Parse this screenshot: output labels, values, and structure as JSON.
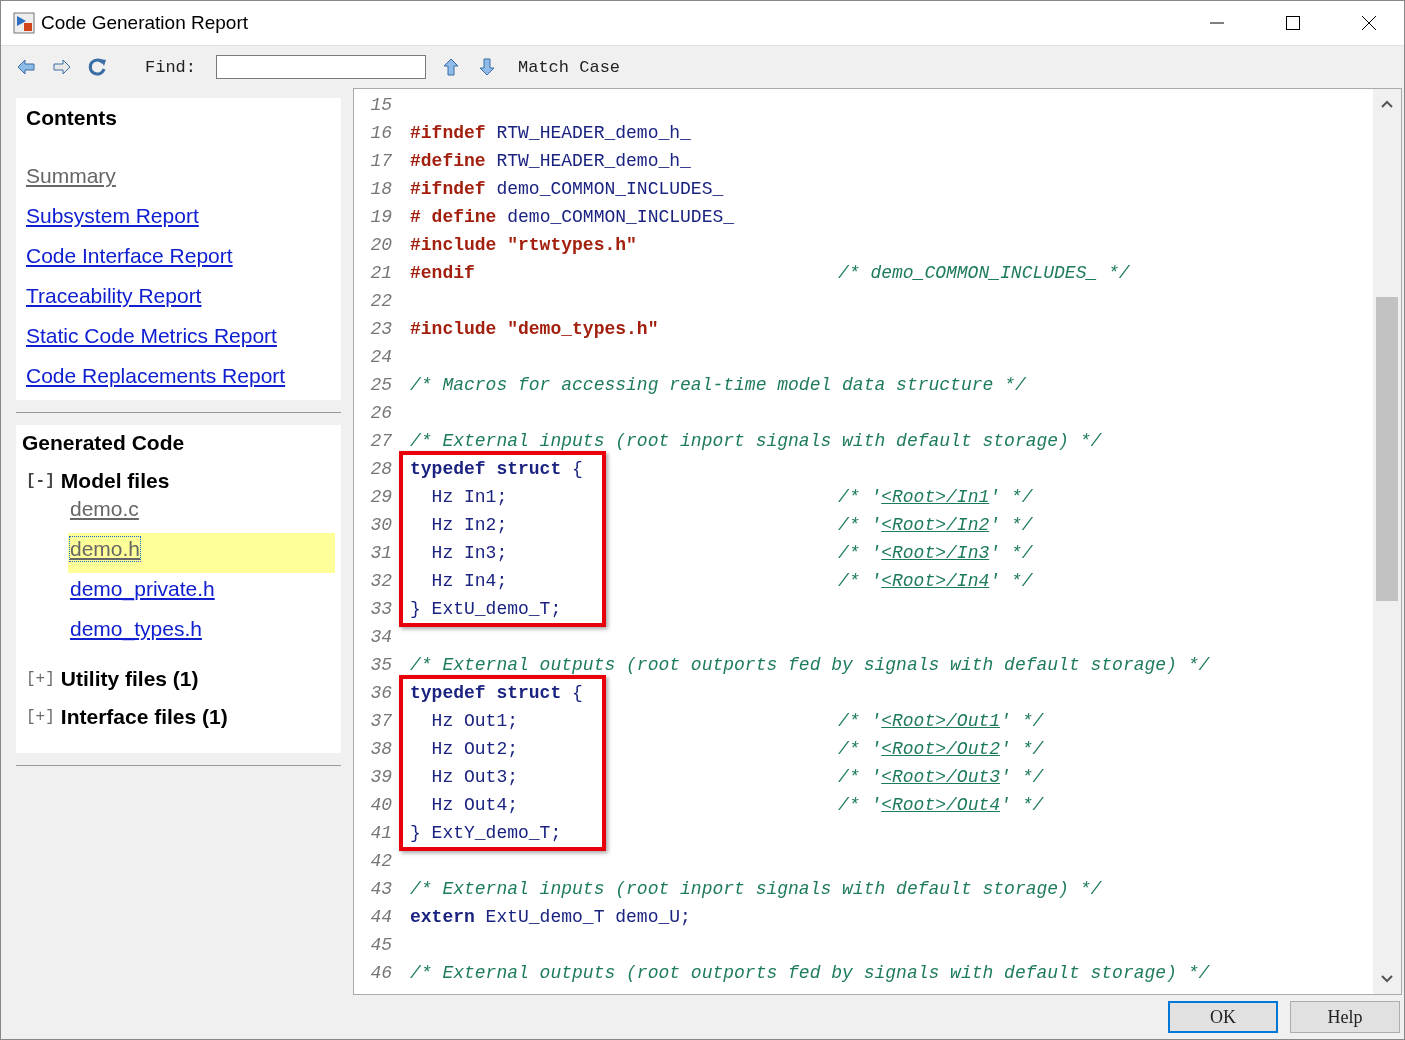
{
  "window": {
    "title": "Code Generation Report"
  },
  "toolbar": {
    "find_label": "Find:",
    "match_case": "Match Case"
  },
  "contents": {
    "title": "Contents",
    "links": [
      {
        "label": "Summary",
        "visited": true
      },
      {
        "label": "Subsystem Report",
        "visited": false
      },
      {
        "label": "Code Interface Report",
        "visited": false
      },
      {
        "label": "Traceability Report",
        "visited": false
      },
      {
        "label": "Static Code Metrics Report",
        "visited": false
      },
      {
        "label": "Code Replacements Report",
        "visited": false
      }
    ]
  },
  "generated_code": {
    "title": "Generated Code",
    "groups": [
      {
        "toggle": "[-]",
        "label": "Model files",
        "expanded": true,
        "files": [
          {
            "label": "demo.c",
            "visited": true,
            "selected": false
          },
          {
            "label": "demo.h",
            "visited": true,
            "selected": true
          },
          {
            "label": "demo_private.h",
            "visited": false,
            "selected": false
          },
          {
            "label": "demo_types.h",
            "visited": false,
            "selected": false
          }
        ]
      },
      {
        "toggle": "[+]",
        "label": "Utility files (1)",
        "expanded": false
      },
      {
        "toggle": "[+]",
        "label": "Interface files (1)",
        "expanded": false
      }
    ]
  },
  "code": {
    "lines": [
      {
        "number": "15",
        "boxed": false
      },
      {
        "number": "16",
        "boxed": false,
        "segments": [
          {
            "kind": "directive",
            "text": "#ifndef"
          },
          {
            "kind": "plain",
            "text": " RTW_HEADER_demo_h_"
          }
        ]
      },
      {
        "number": "17",
        "boxed": false,
        "segments": [
          {
            "kind": "directive",
            "text": "#define"
          },
          {
            "kind": "plain",
            "text": " RTW_HEADER_demo_h_"
          }
        ]
      },
      {
        "number": "18",
        "boxed": false,
        "segments": [
          {
            "kind": "directive",
            "text": "#ifndef"
          },
          {
            "kind": "plain",
            "text": " demo_COMMON_INCLUDES_"
          }
        ]
      },
      {
        "number": "19",
        "boxed": false,
        "segments": [
          {
            "kind": "directive",
            "text": "# define"
          },
          {
            "kind": "plain",
            "text": " demo_COMMON_INCLUDES_"
          }
        ]
      },
      {
        "number": "20",
        "boxed": false,
        "segments": [
          {
            "kind": "directive",
            "text": "#include \"rtwtypes.h\""
          }
        ]
      },
      {
        "number": "21",
        "boxed": false,
        "segments": [
          {
            "kind": "directive",
            "text": "#endif"
          }
        ],
        "trailing": [
          {
            "kind": "comment",
            "text": "/* demo_COMMON_INCLUDES_ */"
          }
        ]
      },
      {
        "number": "22",
        "boxed": false
      },
      {
        "number": "23",
        "boxed": false,
        "segments": [
          {
            "kind": "directive",
            "text": "#include \"demo_types.h\""
          }
        ]
      },
      {
        "number": "24",
        "boxed": false
      },
      {
        "number": "25",
        "boxed": false,
        "segments": [
          {
            "kind": "comment",
            "text": "/* Macros for accessing real-time model data structure */"
          }
        ]
      },
      {
        "number": "26",
        "boxed": false
      },
      {
        "number": "27",
        "boxed": false,
        "segments": [
          {
            "kind": "comment",
            "text": "/* External inputs (root inport signals with default storage) */"
          }
        ]
      },
      {
        "number": "28",
        "boxed": true,
        "segments": [
          {
            "kind": "keyword",
            "text": "typedef struct"
          },
          {
            "kind": "plain",
            "text": " {"
          }
        ]
      },
      {
        "number": "29",
        "boxed": true,
        "segments": [
          {
            "kind": "plain",
            "text": "  Hz In1;"
          }
        ],
        "trailing": [
          {
            "kind": "comment",
            "text": "/* '"
          },
          {
            "kind": "link",
            "text": "<Root>/In1"
          },
          {
            "kind": "comment",
            "text": "' */"
          }
        ]
      },
      {
        "number": "30",
        "boxed": true,
        "segments": [
          {
            "kind": "plain",
            "text": "  Hz In2;"
          }
        ],
        "trailing": [
          {
            "kind": "comment",
            "text": "/* '"
          },
          {
            "kind": "link",
            "text": "<Root>/In2"
          },
          {
            "kind": "comment",
            "text": "' */"
          }
        ]
      },
      {
        "number": "31",
        "boxed": true,
        "segments": [
          {
            "kind": "plain",
            "text": "  Hz In3;"
          }
        ],
        "trailing": [
          {
            "kind": "comment",
            "text": "/* '"
          },
          {
            "kind": "link",
            "text": "<Root>/In3"
          },
          {
            "kind": "comment",
            "text": "' */"
          }
        ]
      },
      {
        "number": "32",
        "boxed": true,
        "segments": [
          {
            "kind": "plain",
            "text": "  Hz In4;"
          }
        ],
        "trailing": [
          {
            "kind": "comment",
            "text": "/* '"
          },
          {
            "kind": "link",
            "text": "<Root>/In4"
          },
          {
            "kind": "comment",
            "text": "' */"
          }
        ]
      },
      {
        "number": "33",
        "boxed": true,
        "segments": [
          {
            "kind": "plain",
            "text": "} ExtU_demo_T;"
          }
        ]
      },
      {
        "number": "34",
        "boxed": false
      },
      {
        "number": "35",
        "boxed": false,
        "segments": [
          {
            "kind": "comment",
            "text": "/* External outputs (root outports fed by signals with default storage) */"
          }
        ]
      },
      {
        "number": "36",
        "boxed": true,
        "segments": [
          {
            "kind": "keyword",
            "text": "typedef struct"
          },
          {
            "kind": "plain",
            "text": " {"
          }
        ]
      },
      {
        "number": "37",
        "boxed": true,
        "segments": [
          {
            "kind": "plain",
            "text": "  Hz Out1;"
          }
        ],
        "trailing": [
          {
            "kind": "comment",
            "text": "/* '"
          },
          {
            "kind": "link",
            "text": "<Root>/Out1"
          },
          {
            "kind": "comment",
            "text": "' */"
          }
        ]
      },
      {
        "number": "38",
        "boxed": true,
        "segments": [
          {
            "kind": "plain",
            "text": "  Hz Out2;"
          }
        ],
        "trailing": [
          {
            "kind": "comment",
            "text": "/* '"
          },
          {
            "kind": "link",
            "text": "<Root>/Out2"
          },
          {
            "kind": "comment",
            "text": "' */"
          }
        ]
      },
      {
        "number": "39",
        "boxed": true,
        "segments": [
          {
            "kind": "plain",
            "text": "  Hz Out3;"
          }
        ],
        "trailing": [
          {
            "kind": "comment",
            "text": "/* '"
          },
          {
            "kind": "link",
            "text": "<Root>/Out3"
          },
          {
            "kind": "comment",
            "text": "' */"
          }
        ]
      },
      {
        "number": "40",
        "boxed": true,
        "segments": [
          {
            "kind": "plain",
            "text": "  Hz Out4;"
          }
        ],
        "trailing": [
          {
            "kind": "comment",
            "text": "/* '"
          },
          {
            "kind": "link",
            "text": "<Root>/Out4"
          },
          {
            "kind": "comment",
            "text": "' */"
          }
        ]
      },
      {
        "number": "41",
        "boxed": true,
        "segments": [
          {
            "kind": "plain",
            "text": "} ExtY_demo_T;"
          }
        ]
      },
      {
        "number": "42",
        "boxed": false
      },
      {
        "number": "43",
        "boxed": false,
        "segments": [
          {
            "kind": "comment",
            "text": "/* External inputs (root inport signals with default storage) */"
          }
        ]
      },
      {
        "number": "44",
        "boxed": false,
        "segments": [
          {
            "kind": "keyword",
            "text": "extern"
          },
          {
            "kind": "plain",
            "text": " ExtU_demo_T demo_U;"
          }
        ]
      },
      {
        "number": "45",
        "boxed": false
      },
      {
        "number": "46",
        "boxed": false,
        "segments": [
          {
            "kind": "comment",
            "text": "/* External outputs (root outports fed by signals with default storage) */"
          }
        ]
      }
    ]
  },
  "buttons": [
    {
      "label": "OK",
      "default": true
    },
    {
      "label": "Help",
      "default": false
    }
  ]
}
